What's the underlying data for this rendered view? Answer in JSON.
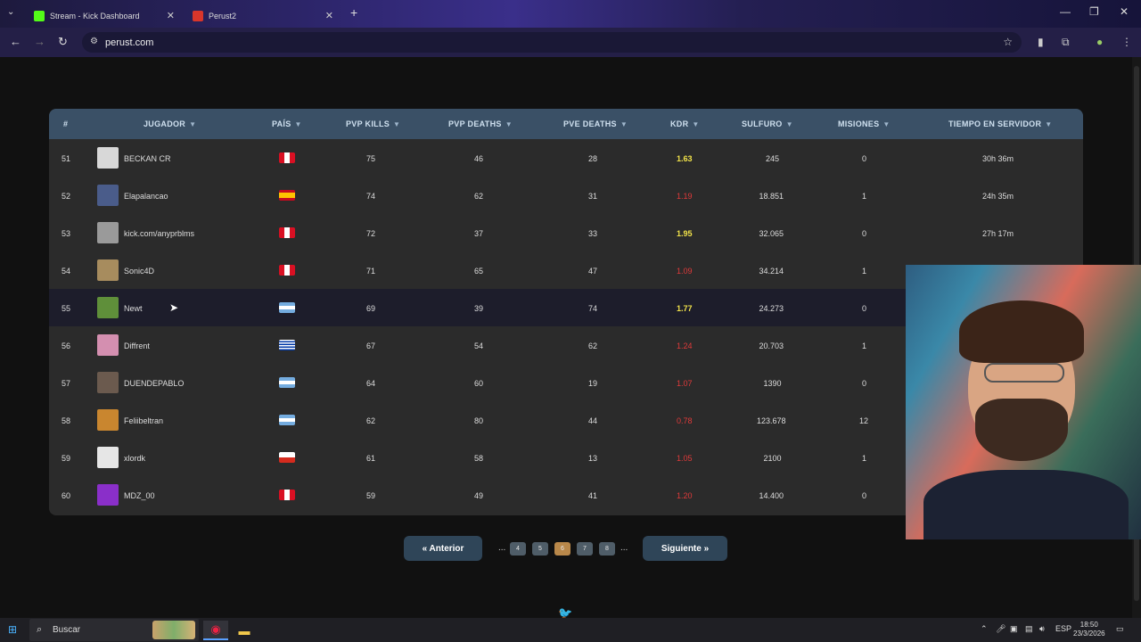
{
  "browser": {
    "tabs": [
      {
        "label": "Stream - Kick Dashboard",
        "color": "#53fc18"
      },
      {
        "label": "Perust2",
        "color": "#d9362b"
      }
    ],
    "close_glyph": "✕",
    "new_tab_glyph": "+",
    "url": "perust.com"
  },
  "table": {
    "headers": [
      "#",
      "JUGADOR",
      "PAÍS",
      "PVP KILLS",
      "PVP DEATHS",
      "PVE DEATHS",
      "KDR",
      "SULFURO",
      "MISIONES",
      "TIEMPO EN SERVIDOR"
    ],
    "rows": [
      {
        "rank": "51",
        "player": "BECKAN CR",
        "country": "peru",
        "pvp_kills": "75",
        "pvp_deaths": "46",
        "pve_deaths": "28",
        "kdr": "1.63",
        "kdr_good": true,
        "sulfuro": "245",
        "misiones": "0",
        "tiempo": "30h 36m",
        "avatar_color": "#d8d8d8"
      },
      {
        "rank": "52",
        "player": "Elapalancao",
        "country": "spain",
        "pvp_kills": "74",
        "pvp_deaths": "62",
        "pve_deaths": "31",
        "kdr": "1.19",
        "kdr_good": false,
        "sulfuro": "18.851",
        "misiones": "1",
        "tiempo": "24h 35m",
        "avatar_color": "#4a5c8a"
      },
      {
        "rank": "53",
        "player": "kick.com/anyprblms",
        "country": "peru",
        "pvp_kills": "72",
        "pvp_deaths": "37",
        "pve_deaths": "33",
        "kdr": "1.95",
        "kdr_good": true,
        "sulfuro": "32.065",
        "misiones": "0",
        "tiempo": "27h 17m",
        "avatar_color": "#9a9a9a"
      },
      {
        "rank": "54",
        "player": "Sonic4D",
        "country": "peru",
        "pvp_kills": "71",
        "pvp_deaths": "65",
        "pve_deaths": "47",
        "kdr": "1.09",
        "kdr_good": false,
        "sulfuro": "34.214",
        "misiones": "1",
        "tiempo": "",
        "avatar_color": "#a78c5e"
      },
      {
        "rank": "55",
        "player": "Newt",
        "country": "argentina",
        "pvp_kills": "69",
        "pvp_deaths": "39",
        "pve_deaths": "74",
        "kdr": "1.77",
        "kdr_good": true,
        "sulfuro": "24.273",
        "misiones": "0",
        "tiempo": "",
        "avatar_color": "#5f8f3a"
      },
      {
        "rank": "56",
        "player": "Diffrent",
        "country": "uruguay",
        "pvp_kills": "67",
        "pvp_deaths": "54",
        "pve_deaths": "62",
        "kdr": "1.24",
        "kdr_good": false,
        "sulfuro": "20.703",
        "misiones": "1",
        "tiempo": "",
        "avatar_color": "#d48fb0"
      },
      {
        "rank": "57",
        "player": "DUENDEPABLO",
        "country": "argentina",
        "pvp_kills": "64",
        "pvp_deaths": "60",
        "pve_deaths": "19",
        "kdr": "1.07",
        "kdr_good": false,
        "sulfuro": "1390",
        "misiones": "0",
        "tiempo": "",
        "avatar_color": "#6b5a4e"
      },
      {
        "rank": "58",
        "player": "Feliibeltran",
        "country": "argentina",
        "pvp_kills": "62",
        "pvp_deaths": "80",
        "pve_deaths": "44",
        "kdr": "0.78",
        "kdr_good": false,
        "sulfuro": "123.678",
        "misiones": "12",
        "tiempo": "",
        "avatar_color": "#c9862f"
      },
      {
        "rank": "59",
        "player": "xlordk",
        "country": "chile",
        "pvp_kills": "61",
        "pvp_deaths": "58",
        "pve_deaths": "13",
        "kdr": "1.05",
        "kdr_good": false,
        "sulfuro": "2100",
        "misiones": "1",
        "tiempo": "",
        "avatar_color": "#e6e6e6"
      },
      {
        "rank": "60",
        "player": "MDZ_00",
        "country": "peru",
        "pvp_kills": "59",
        "pvp_deaths": "49",
        "pve_deaths": "41",
        "kdr": "1.20",
        "kdr_good": false,
        "sulfuro": "14.400",
        "misiones": "0",
        "tiempo": "",
        "avatar_color": "#8a2fc9"
      }
    ]
  },
  "pagination": {
    "prev": "« Anterior",
    "next": "Siguiente »",
    "pages": [
      "4",
      "5",
      "6",
      "7",
      "8"
    ],
    "active": "6",
    "ellipsis": "..."
  },
  "taskbar": {
    "search_placeholder": "Buscar",
    "lang": "ESP",
    "time": "18:50",
    "date": "23/3/2026"
  },
  "colors": {
    "header_bg": "#3a5066",
    "kdr_good": "#f2e34a",
    "kdr_bad": "#e03a3a",
    "active_page": "#b9884a"
  }
}
